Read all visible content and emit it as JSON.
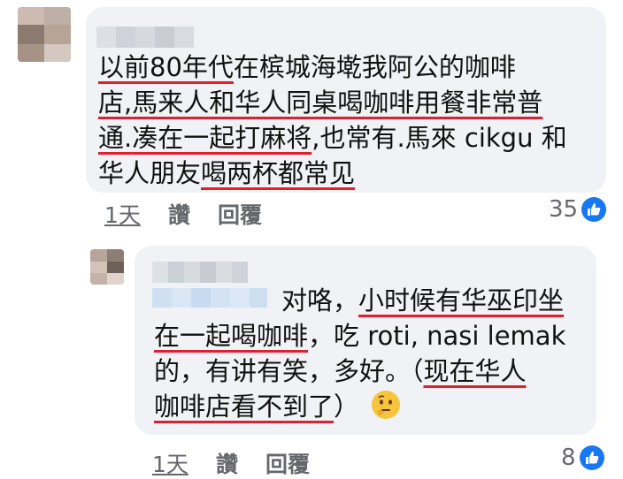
{
  "comment1": {
    "lines": [
      {
        "segments": [
          {
            "text": "以前80年代",
            "u": true
          },
          {
            "text": "在槟城海墘我阿公的咖啡",
            "u": false
          }
        ]
      },
      {
        "segments": [
          {
            "text": "店,",
            "u": true
          },
          {
            "text": "馬来人和华人同桌喝咖啡用餐非常普",
            "u": true
          }
        ]
      },
      {
        "segments": [
          {
            "text": "通.",
            "u": true
          },
          {
            "text": "凑在一起打麻将",
            "u": true
          },
          {
            "text": ",也常有.馬來 cikgu 和",
            "u": false
          }
        ]
      },
      {
        "segments": [
          {
            "text": "华人朋友",
            "u": false
          },
          {
            "text": "喝两杯都常见",
            "u": true
          }
        ]
      }
    ],
    "time": "1天",
    "like_label": "讚",
    "reply_label": "回覆",
    "reaction_count": "35",
    "reaction_icon": "like-thumb-icon"
  },
  "comment2": {
    "lines": [
      {
        "segments": [
          {
            "text": "对咯，",
            "u": false
          },
          {
            "text": "小时候有华巫印坐",
            "u": true
          }
        ]
      },
      {
        "segments": [
          {
            "text": "在一起喝咖啡",
            "u": true
          },
          {
            "text": "，吃 roti, nasi lemak",
            "u": false
          }
        ]
      },
      {
        "segments": [
          {
            "text": "的，有讲有笑，多好。（",
            "u": false
          },
          {
            "text": "现在华人",
            "u": true
          }
        ]
      },
      {
        "segments": [
          {
            "text": "咖啡店看不到了",
            "u": true
          },
          {
            "text": "）",
            "u": false
          }
        ]
      }
    ],
    "emoji": "thinking-face",
    "time": "1天",
    "like_label": "讚",
    "reply_label": "回覆",
    "reaction_count": "8",
    "reaction_icon": "like-thumb-icon"
  },
  "colors": {
    "bubble": "#f0f2f5",
    "underline": "#e0202a",
    "meta_text": "#65676b",
    "like_blue": "#1877f2"
  }
}
